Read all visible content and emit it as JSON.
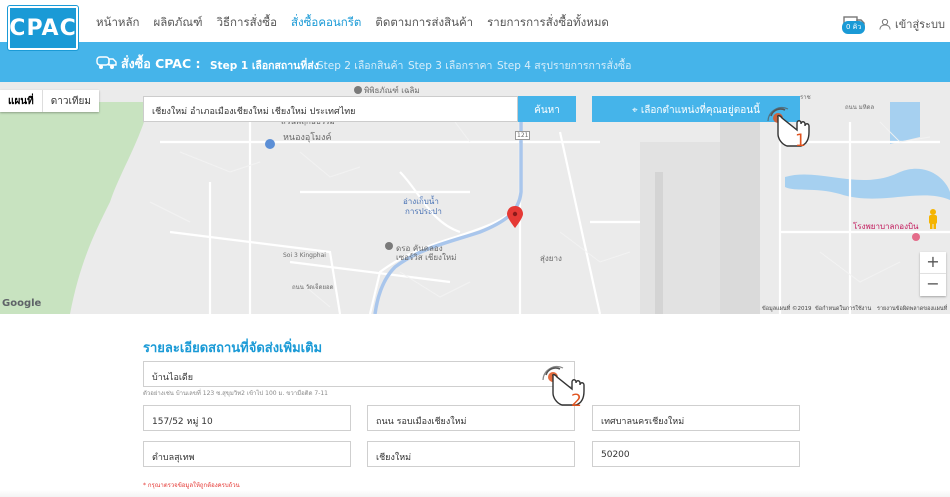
{
  "brand": {
    "logo_text": "CPAC",
    "color": "#1a9ad6"
  },
  "nav": {
    "items": [
      {
        "label": "หน้าหลัก",
        "active": false
      },
      {
        "label": "ผลิตภัณฑ์",
        "active": false
      },
      {
        "label": "วิธีการสั่งซื้อ",
        "active": false
      },
      {
        "label": "สั่งซื้อคอนกรีต",
        "active": true
      },
      {
        "label": "ติดตามการส่งสินค้า",
        "active": false
      },
      {
        "label": "รายการการสั่งซื้อทั้งหมด",
        "active": false
      }
    ],
    "cart_badge": "0 คิว",
    "login_label": "เข้าสู่ระบบ"
  },
  "steps": {
    "title": "สั่งซื้อ CPAC :",
    "items": [
      {
        "label": "Step 1 เลือกสถานที่ส่ง",
        "active": true
      },
      {
        "label": "Step 2 เลือกสินค้า",
        "active": false
      },
      {
        "label": "Step 3 เลือกราคา",
        "active": false
      },
      {
        "label": "Step 4 สรุปรายการการสั่งซื้อ",
        "active": false
      }
    ],
    "bar_color": "#45b4ea"
  },
  "map": {
    "type_buttons": [
      "แผนที่",
      "ดาวเทียม"
    ],
    "search_value": "เชียงใหม่ อำเภอเมืองเชียงใหม่ เชียงใหม่ ประเทศไทย",
    "search_button": "ค้นหา",
    "locate_button": "เลือกตำแหน่งที่คุณอยู่ตอนนี้",
    "labels": {
      "l1": "หนองอุโมงค์",
      "l2": "อ่างเก็บน้ำ",
      "l3": "การประปา",
      "l4": "ดรอ คันคลอง",
      "l5": "เซอร์วิส เชียงใหม่",
      "l6": "โรงพยาบาลกองบิน",
      "l7": "พิพิธภัณฑ์ เฉลิม",
      "l8": "สวนพฤกษธรรม",
      "l9": "สุ่งยาง",
      "l10": "Soi 3 Kingphai",
      "l11": "ถนน วัดเจ็ดยอด",
      "l12": "ถนน มหิดล",
      "l13": "121",
      "l14": "ราช"
    },
    "zoom_in": "+",
    "zoom_out": "−",
    "google": "Google",
    "attribution": [
      "ข้อมูลแผนที่ ©2019",
      "ข้อกำหนดในการใช้งาน",
      "รายงานข้อผิดพลาดของแผนที่"
    ]
  },
  "form": {
    "title": "รายละเอียดสถานที่จัดส่งเพิ่มเติม",
    "place_name": "บ้านไอเดีย",
    "hint": "ตัวอย่างเช่น บ้านเลขที่ 123 ซ.สุขุมวิท2 เข้าไป 100 ม. ขวามือติด 7-11",
    "house_no": "157/52 หมู่ 10",
    "road": "ถนน รอบเมืองเชียงใหม่",
    "municipality": "เทศบาลนครเชียงใหม่",
    "subdistrict": "ตำบลสุเทพ",
    "province": "เชียงใหม่",
    "postcode": "50200",
    "note": "* กรุณาตรวจข้อมูลให้ถูกต้องครบถ้วน"
  },
  "annotations": {
    "hand1": "1",
    "hand2": "2"
  }
}
